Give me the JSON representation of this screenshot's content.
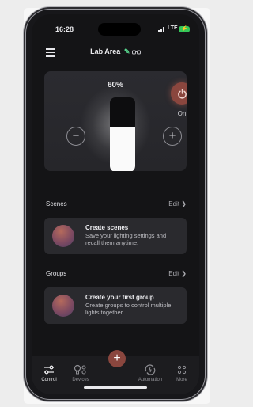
{
  "status_bar": {
    "time": "16:28",
    "network": "LTE"
  },
  "header": {
    "title": "Lab Area"
  },
  "light_panel": {
    "brightness_label": "60%",
    "brightness_level": 0.6,
    "power_label": "On"
  },
  "scenes": {
    "section_label": "Scenes",
    "edit_label": "Edit",
    "card_title": "Create scenes",
    "card_description": "Save your lighting settings and recall them anytime."
  },
  "groups": {
    "section_label": "Groups",
    "edit_label": "Edit",
    "card_title": "Create your first group",
    "card_description": "Create groups to control multiple lights together."
  },
  "tabbar": {
    "items": [
      {
        "label": "Control",
        "icon": "sliders-icon",
        "active": true
      },
      {
        "label": "Devices",
        "icon": "bulbs-icon",
        "active": false
      },
      {
        "label": "Automation",
        "icon": "automation-icon",
        "active": false
      },
      {
        "label": "More",
        "icon": "more-icon",
        "active": false
      }
    ],
    "add_icon": "plus-icon"
  },
  "colors": {
    "accent": "#8a463e",
    "background": "#141416",
    "card": "#2a2a2e"
  }
}
